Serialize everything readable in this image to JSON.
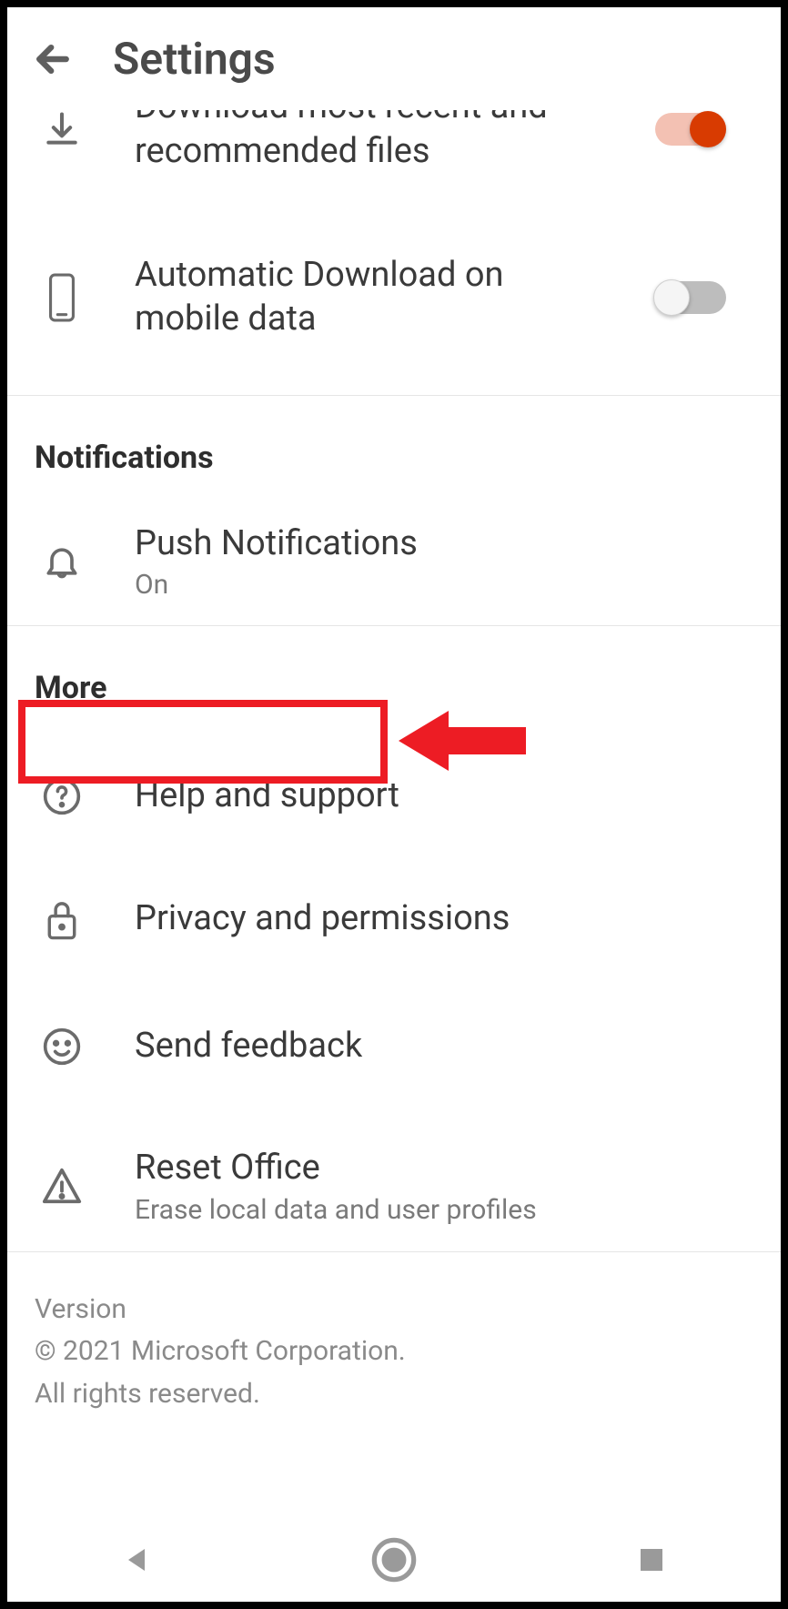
{
  "header": {
    "title": "Settings"
  },
  "items": {
    "download_recent": {
      "label": "Download most recent and recommended files",
      "toggle": "on"
    },
    "auto_mobile": {
      "label": "Automatic Download on mobile data",
      "toggle": "off"
    }
  },
  "sections": {
    "notifications": {
      "heading": "Notifications",
      "push": {
        "label": "Push Notifications",
        "sub": "On"
      }
    },
    "more": {
      "heading": "More",
      "help": {
        "label": "Help and support"
      },
      "privacy": {
        "label": "Privacy and permissions"
      },
      "feedback": {
        "label": "Send feedback"
      },
      "reset": {
        "label": "Reset Office",
        "sub": "Erase local data and user profiles"
      }
    }
  },
  "footer": {
    "version": "Version",
    "copyright": "© 2021 Microsoft Corporation.",
    "rights": "All rights reserved."
  }
}
